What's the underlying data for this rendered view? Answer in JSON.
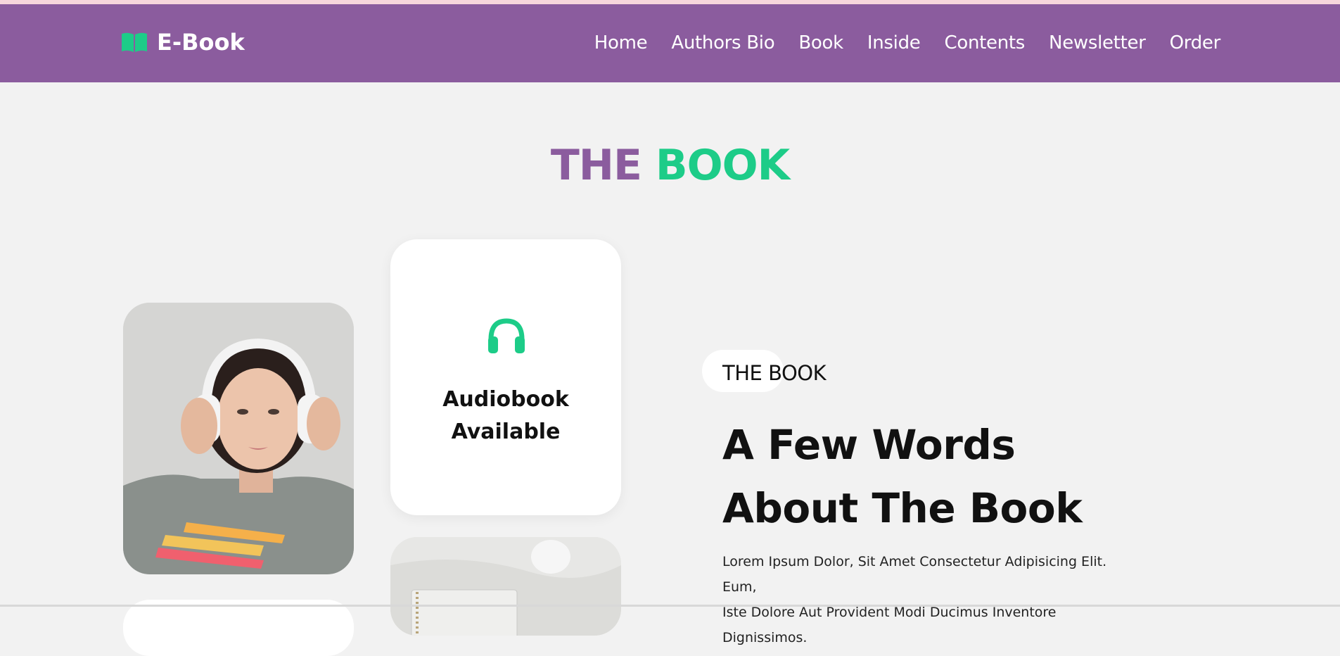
{
  "brand": {
    "name": "E-Book",
    "icon": "open-book-icon"
  },
  "nav": {
    "items": [
      "Home",
      "Authors Bio",
      "Book",
      "Inside",
      "Contents",
      "Newsletter",
      "Order"
    ]
  },
  "section": {
    "title_part1": "THE",
    "title_part2": "BOOK"
  },
  "audio_card": {
    "icon": "headphones-icon",
    "line1": "Audiobook",
    "line2": "Available"
  },
  "about": {
    "eyebrow": "THE BOOK",
    "headline_line1": "A Few Words",
    "headline_line2": "About The Book",
    "paragraph_line1": "Lorem Ipsum Dolor, Sit Amet Consectetur Adipisicing Elit. Eum,",
    "paragraph_line2": "Iste Dolore Aut Provident Modi Ducimus Inventore Dignissimos."
  },
  "colors": {
    "header_bg": "#8b5c9e",
    "accent_green": "#1dcc88",
    "title_purple": "#8b5c9e",
    "page_bg": "#f2f2f2"
  }
}
